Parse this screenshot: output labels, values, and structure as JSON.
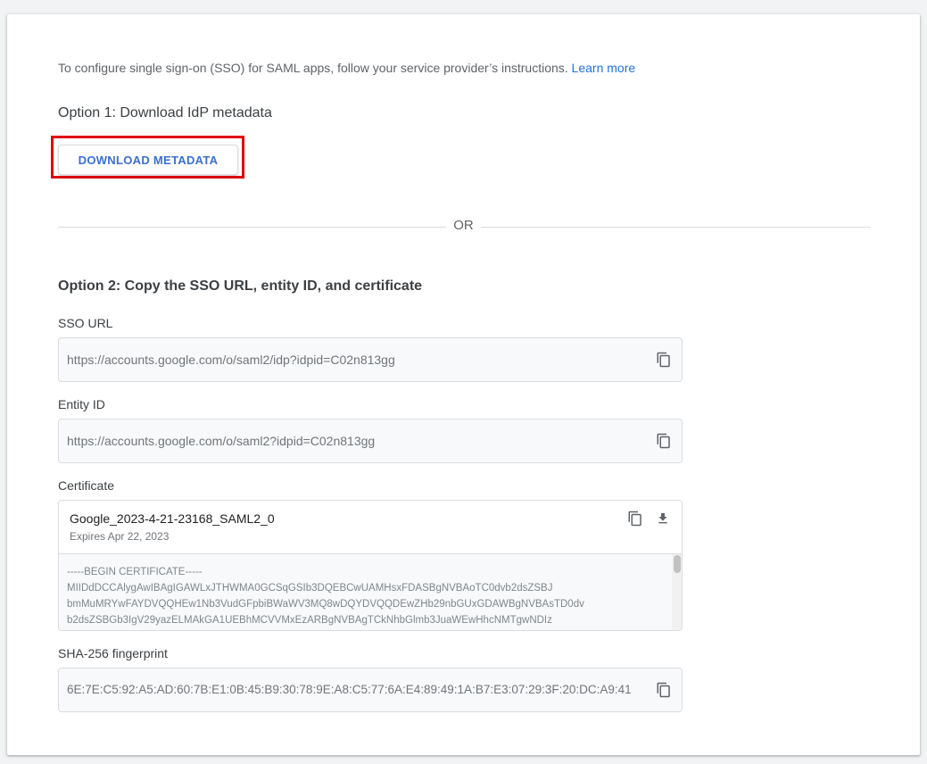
{
  "intro": {
    "text": "To configure single sign-on (SSO) for SAML apps, follow your service provider’s instructions.",
    "link": "Learn more"
  },
  "option1": {
    "heading": "Option 1: Download IdP metadata",
    "button_label": "DOWNLOAD METADATA"
  },
  "divider": {
    "label": "OR"
  },
  "option2": {
    "heading": "Option 2: Copy the SSO URL, entity ID, and certificate",
    "sso_url": {
      "label": "SSO URL",
      "value": "https://accounts.google.com/o/saml2/idp?idpid=C02n813gg"
    },
    "entity_id": {
      "label": "Entity ID",
      "value": "https://accounts.google.com/o/saml2?idpid=C02n813gg"
    },
    "certificate": {
      "label": "Certificate",
      "name": "Google_2023-4-21-23168_SAML2_0",
      "expires": "Expires Apr 22, 2023",
      "lines": [
        "-----BEGIN CERTIFICATE-----",
        "MIIDdDCCAlygAwIBAgIGAWLxJTHWMA0GCSqGSIb3DQEBCwUAMHsxFDASBgNVBAoTC0dvb2dsZSBJ",
        "bmMuMRYwFAYDVQQHEw1Nb3VudGFpbiBWaWV3MQ8wDQYDVQQDEwZHb29nbGUxGDAWBgNVBAsTD0dv",
        "b2dsZSBGb3IgV29yazELMAkGA1UEBhMCVVMxEzARBgNVBAgTCkNhbGlmb3JuaWEwHhcNMTgwNDIz"
      ]
    },
    "sha256": {
      "label": "SHA-256 fingerprint",
      "value": "6E:7E:C5:92:A5:AD:60:7B:E1:0B:45:B9:30:78:9E:A8:C5:77:6A:E4:89:49:1A:B7:E3:07:29:3F:20:DC:A9:41"
    }
  },
  "icons": {
    "copy": "copy-icon",
    "download": "download-icon"
  },
  "colors": {
    "link": "#1a73e8",
    "button_text": "#3b6fd6",
    "highlight": "#e00000"
  }
}
